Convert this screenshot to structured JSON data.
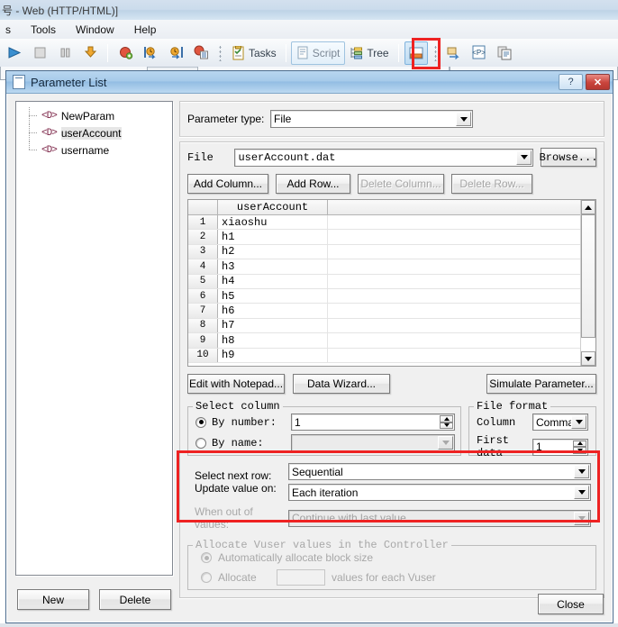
{
  "app": {
    "title": "号 - Web (HTTP/HTML)]",
    "menu": [
      "s",
      "Tools",
      "Window",
      "Help"
    ],
    "toolbar": {
      "run_icon": "run-play-icon",
      "stop_icon": "stop-square-icon",
      "pause_icon": "pause-icon",
      "download_icon": "download-arrow-icon",
      "record_icon": "record-ball-icon",
      "step_into_icon": "step-into-icon",
      "step_out_icon": "step-out-icon",
      "snapshot_icon": "snapshot-icon",
      "tasks_label": "Tasks",
      "tasks_icon": "tasks-clipboard-icon",
      "script_label": "Script",
      "script_icon": "script-page-icon",
      "tree_label": "Tree",
      "tree_icon": "tree-list-icon",
      "split_icon": "split-view-icon",
      "transaction_icon": "transaction-icon",
      "parameter_icon": "<P>",
      "parameter_icon_name": "parameter-list-icon",
      "copy_icon": "copy-page-icon"
    }
  },
  "dialog": {
    "title": "Parameter List",
    "help_label": "?",
    "close_label": "✕",
    "tree": {
      "items": [
        {
          "icon": "<D>",
          "label": "NewParam",
          "selected": false
        },
        {
          "icon": "<D>",
          "label": "userAccount",
          "selected": true
        },
        {
          "icon": "<D>",
          "label": "username",
          "selected": false
        }
      ]
    },
    "new_button": "New",
    "delete_button": "Delete",
    "close_button": "Close",
    "parameter_type": {
      "label": "Parameter type:",
      "value": "File"
    },
    "file": {
      "label": "File",
      "value": "userAccount.dat",
      "browse_button": "Browse..."
    },
    "grid_buttons": {
      "add_column": "Add Column...",
      "add_row": "Add Row...",
      "delete_column": "Delete Column...",
      "delete_row": "Delete Row..."
    },
    "grid": {
      "column_header": "userAccount",
      "rows": [
        {
          "num": "1",
          "value": "xiaoshu"
        },
        {
          "num": "2",
          "value": "h1"
        },
        {
          "num": "3",
          "value": "h2"
        },
        {
          "num": "4",
          "value": "h3"
        },
        {
          "num": "5",
          "value": "h4"
        },
        {
          "num": "6",
          "value": "h5"
        },
        {
          "num": "7",
          "value": "h6"
        },
        {
          "num": "8",
          "value": "h7"
        },
        {
          "num": "9",
          "value": "h8"
        },
        {
          "num": "10",
          "value": "h9"
        }
      ]
    },
    "tool_buttons": {
      "edit_notepad": "Edit with Notepad...",
      "data_wizard": "Data Wizard...",
      "simulate_parameter": "Simulate Parameter..."
    },
    "select_column": {
      "legend": "Select column",
      "by_number_label": "By number:",
      "by_number_value": "1",
      "by_number_selected": true,
      "by_name_label": "By name:",
      "by_name_value": "",
      "by_name_selected": false
    },
    "file_format": {
      "legend": "File format",
      "column_label": "Column",
      "column_value": "Comma",
      "first_data_label": "First data",
      "first_data_value": "1"
    },
    "row_settings": {
      "select_next_row_label": "Select next row:",
      "select_next_row_value": "Sequential",
      "update_value_on_label": "Update value on:",
      "update_value_on_value": "Each iteration",
      "when_out_of_values_label": "When out of values:",
      "when_out_of_values_value": "Continue with last value"
    },
    "allocate": {
      "legend": "Allocate Vuser values in the Controller",
      "auto_label": "Automatically allocate block size",
      "auto_selected": true,
      "allocate_label": "Allocate",
      "allocate_value": "",
      "allocate_suffix": "values for each Vuser",
      "allocate_selected": false
    }
  },
  "colors": {
    "highlight": "#ee2222",
    "dialog_title_from": "#b8d6ef",
    "accent": "#2d4763"
  }
}
